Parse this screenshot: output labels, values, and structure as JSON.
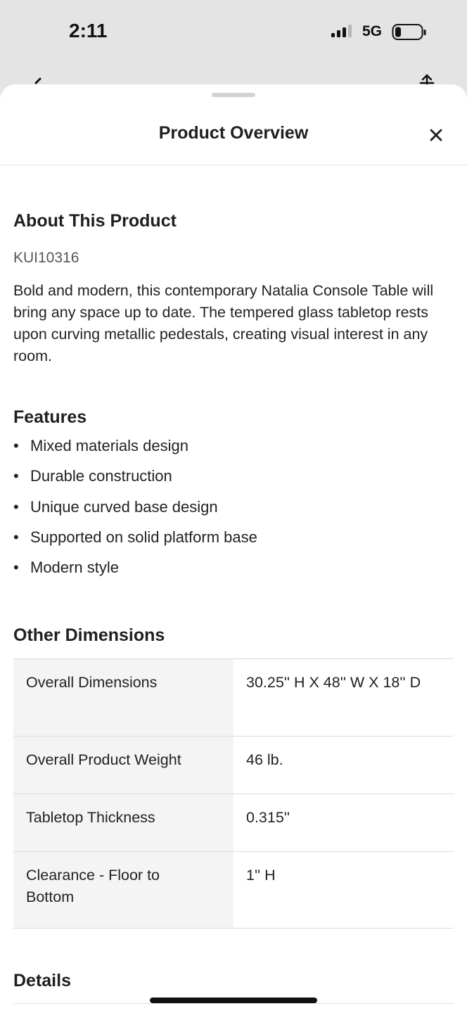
{
  "status_bar": {
    "time": "2:11",
    "network": "5G",
    "signal_icon": "cellular-signal-icon",
    "battery_icon": "battery-low-icon"
  },
  "sheet": {
    "title": "Product Overview",
    "close_icon": "close-icon"
  },
  "about": {
    "heading": "About This Product",
    "sku": "KUI10316",
    "description": "Bold and modern, this contemporary Natalia Console Table will bring any space up to date. The tempered glass tabletop rests upon curving metallic pedestals, creating visual interest in any room."
  },
  "features": {
    "heading": "Features",
    "items": [
      "Mixed materials design",
      "Durable construction",
      "Unique curved base design",
      "Supported on solid platform base",
      "Modern style"
    ]
  },
  "dimensions": {
    "heading": "Other Dimensions",
    "rows": [
      {
        "label": "Overall Dimensions",
        "value": "30.25'' H X 48'' W X 18'' D"
      },
      {
        "label": "Overall Product Weight",
        "value": "46 lb."
      },
      {
        "label": "Tabletop Thickness",
        "value": "0.315''"
      },
      {
        "label": "Clearance - Floor to Bottom",
        "value": "1'' H"
      }
    ]
  },
  "details": {
    "heading": "Details"
  },
  "colors": {
    "text": "#1f1f1f",
    "muted": "#555555",
    "table_label_bg": "#f4f4f4",
    "divider": "#dcdcdc"
  }
}
